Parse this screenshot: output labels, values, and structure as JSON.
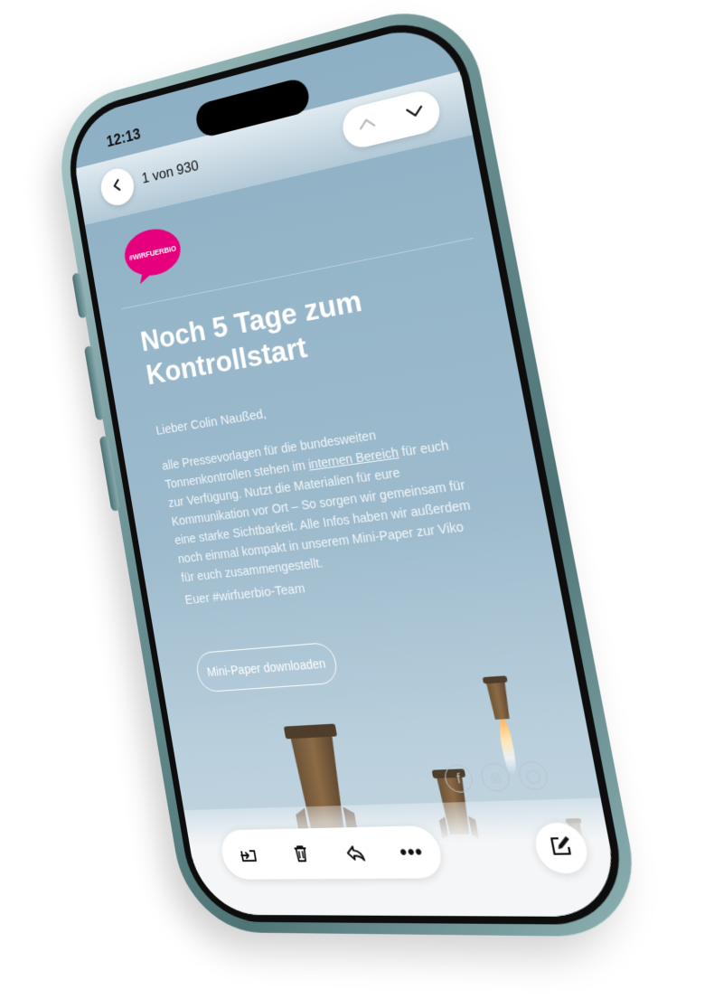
{
  "status_bar": {
    "time": "12:13"
  },
  "header": {
    "counter": "1 von 930",
    "back_icon": "chevron-left-icon",
    "prev_icon": "chevron-up-icon",
    "next_icon": "chevron-down-icon"
  },
  "email": {
    "logo_text": "#WIRFUERBIO",
    "logo_color": "#e6007e",
    "title_line1": "Noch 5 Tage zum",
    "title_line2": "Kontrollstart",
    "greeting": "Lieber Colin Naußed,",
    "body_part1": "alle Pressevorlagen für die bundesweiten Tonnenkontrollen stehen im ",
    "body_link": "internen Bereich",
    "body_part2": " für euch zur Verfügung. Nutzt die Materialien für eure Kommunikation vor Ort – So sorgen wir gemeinsam für eine starke Sichtbarkeit. Alle Infos haben wir außerdem noch einmal kompakt in unserem Mini-Paper zur Viko für euch zusammengestellt.",
    "signoff": "Euer #wirfuerbio-Team",
    "cta_label": "Mini-Paper downloaden"
  },
  "socials": [
    "facebook-icon",
    "instagram-icon",
    "social-icon"
  ],
  "toolbar": {
    "items": [
      "move-to-folder-icon",
      "trash-icon",
      "reply-icon",
      "more-icon"
    ],
    "compose_icon": "compose-icon"
  }
}
